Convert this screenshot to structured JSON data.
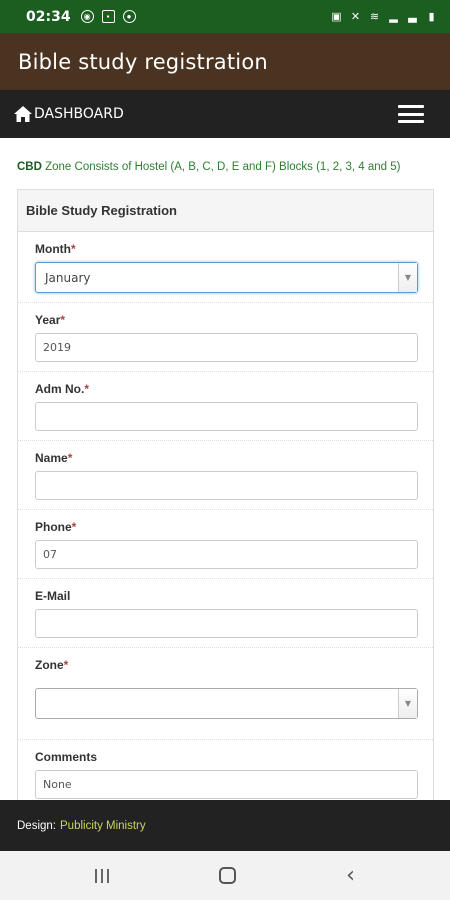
{
  "status_bar": {
    "time": "02:34"
  },
  "app_bar": {
    "title": "Bible study registration"
  },
  "nav": {
    "home_label": "DASHBOARD",
    "home_icon": "home-icon",
    "menu_icon": "hamburger-menu-icon"
  },
  "notice": {
    "prefix": "CBD",
    "text": " Zone Consists of Hostel (A, B, C, D, E and F) Blocks (1, 2, 3, 4 and 5)"
  },
  "form": {
    "heading": "Bible Study Registration",
    "required_marker": "*",
    "fields": {
      "month": {
        "label": "Month",
        "value": "January"
      },
      "year": {
        "label": "Year",
        "value": "2019"
      },
      "adm_no": {
        "label": "Adm No.",
        "value": ""
      },
      "name": {
        "label": "Name",
        "value": ""
      },
      "phone": {
        "label": "Phone",
        "value": "07"
      },
      "email": {
        "label": "E-Mail",
        "value": ""
      },
      "zone": {
        "label": "Zone",
        "value": ""
      },
      "comments": {
        "label": "Comments",
        "value": "None"
      }
    }
  },
  "footer": {
    "prefix": "Design:",
    "link_text": "Publicity Ministry"
  },
  "colors": {
    "status_bar": "#1b5e20",
    "app_bar": "#4a3320",
    "nav_bar": "#222222",
    "notice_text": "#2e7d32",
    "required": "#a94442",
    "footer_link": "#c8d65b"
  }
}
